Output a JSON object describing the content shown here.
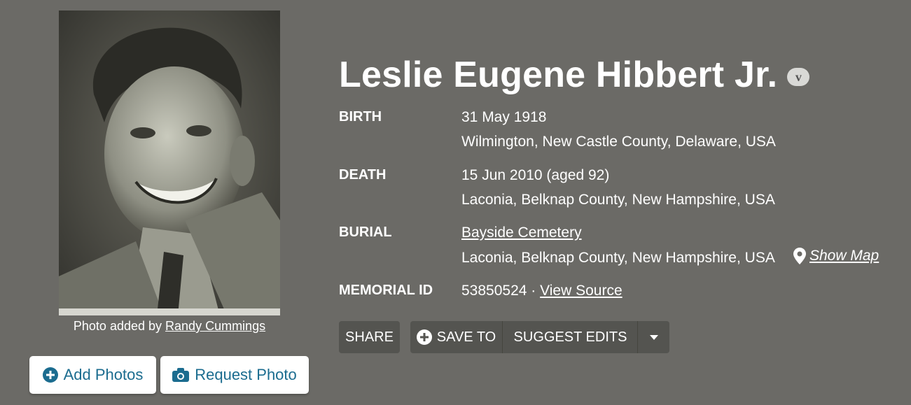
{
  "memorial": {
    "name": "Leslie Eugene Hibbert Jr.",
    "badge": "v"
  },
  "photo": {
    "credit_prefix": "Photo added by",
    "credit_author": "Randy Cummings",
    "add_label": "Add Photos",
    "request_label": "Request Photo"
  },
  "facts": {
    "birth_label": "BIRTH",
    "birth_date": "31 May 1918",
    "birth_place": "Wilmington, New Castle County, Delaware, USA",
    "death_label": "DEATH",
    "death_date": "15 Jun 2010 (aged 92)",
    "death_place": "Laconia, Belknap County, New Hampshire, USA",
    "burial_label": "BURIAL",
    "burial_cemetery": "Bayside Cemetery",
    "burial_place": "Laconia, Belknap County, New Hampshire, USA",
    "show_map": "Show Map",
    "memorial_id_label": "MEMORIAL ID",
    "memorial_id": "53850524",
    "separator": "·",
    "view_source": "View Source"
  },
  "actions": {
    "share": "SHARE",
    "save_to": "SAVE TO",
    "suggest_edits": "SUGGEST EDITS"
  },
  "icons": {
    "add": "plus-circle-icon",
    "camera": "camera-icon",
    "map_pin": "map-pin-icon",
    "caret": "caret-down-icon"
  },
  "colors": {
    "background": "#6b6a66",
    "link_blue": "#1b6c8f",
    "dark_button": "#545450"
  }
}
